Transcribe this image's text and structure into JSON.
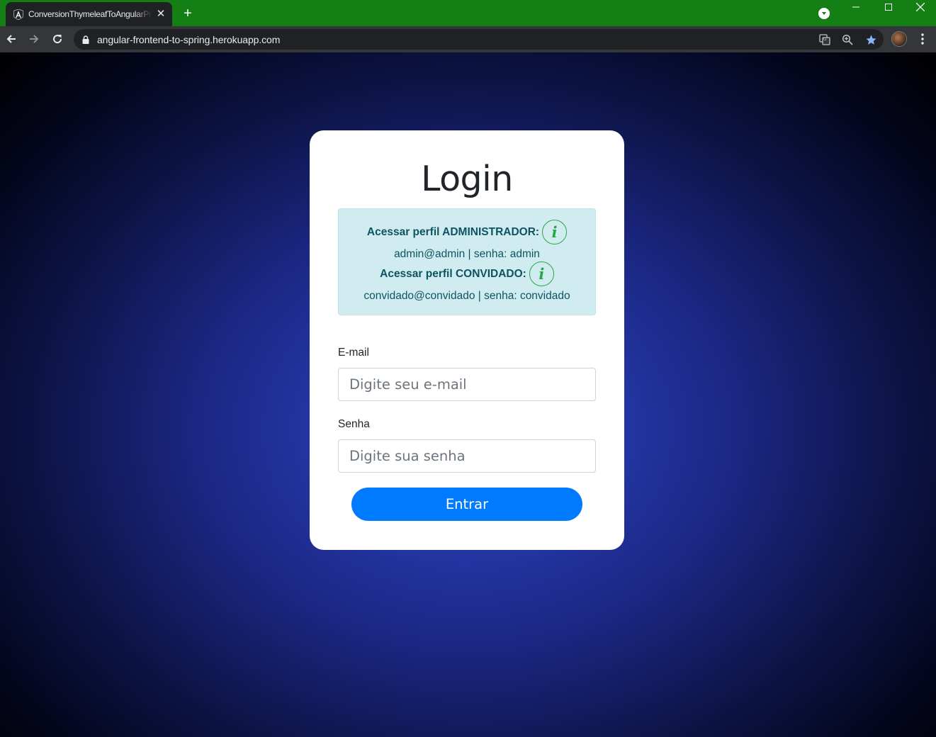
{
  "browser": {
    "tab_title": "ConversionThymeleafToAngularProject",
    "tab_favicon": "angular-icon",
    "url": "angular-frontend-to-spring.herokuapp.com",
    "theme_color": "#137f14"
  },
  "page": {
    "title": "Login",
    "alert": {
      "admin_label": "Acessar perfil ADMINISTRADOR:",
      "admin_credentials": "admin@admin | senha: admin",
      "guest_label": "Acessar perfil CONVIDADO:",
      "guest_credentials": "convidado@convidado | senha: convidado",
      "info_icon": "info-icon"
    },
    "email": {
      "label": "E-mail",
      "placeholder": "Digite seu e-mail",
      "value": ""
    },
    "password": {
      "label": "Senha",
      "placeholder": "Digite sua senha",
      "value": ""
    },
    "submit_label": "Entrar",
    "colors": {
      "primary": "#007bff",
      "alert_bg": "#d1ecf1",
      "alert_text": "#0c5460",
      "info_icon": "#28a745"
    }
  }
}
